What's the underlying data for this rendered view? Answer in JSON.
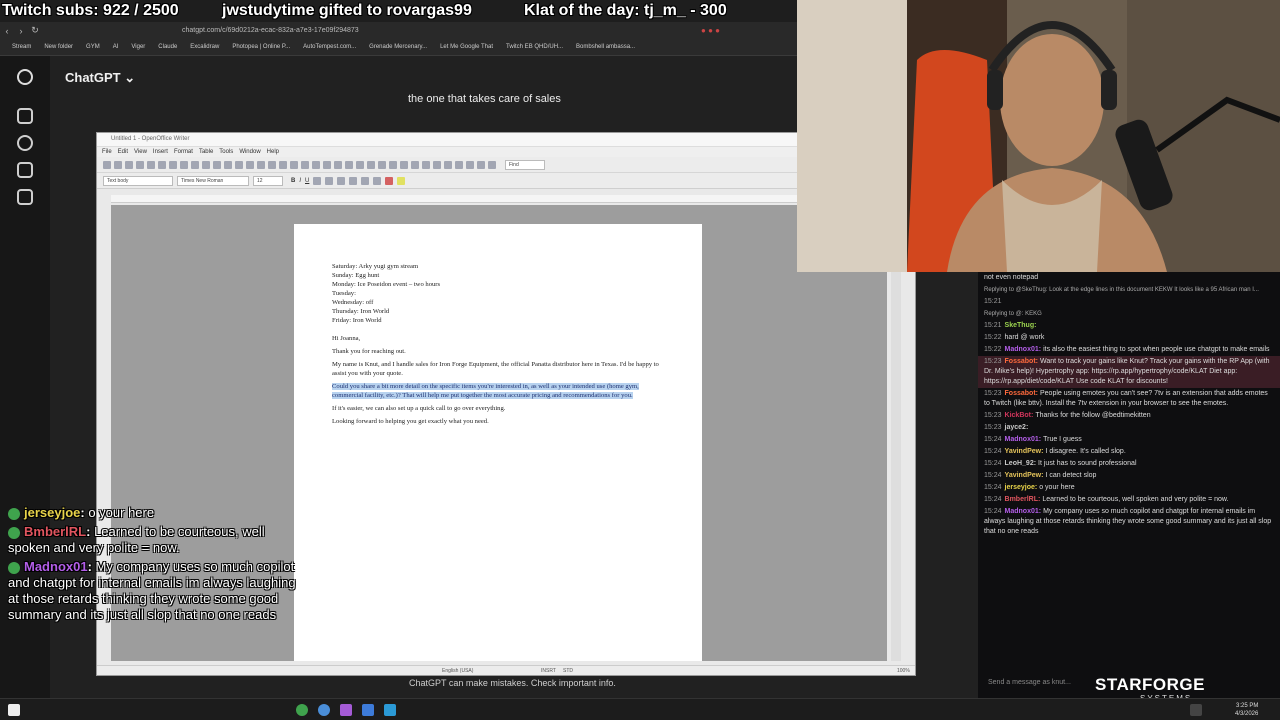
{
  "overlay": {
    "subs": "Twitch subs: 922 / 2500",
    "gift": "jwstudytime gifted to rovargas99",
    "klat": "Klat of the day: tj_m_ - 300"
  },
  "browser": {
    "url": "chatgpt.com/c/69d0212a-ecac-832a-a7e3-17e09f294873",
    "bookmarks": [
      "Stream",
      "New folder",
      "GYM",
      "AI",
      "Viger",
      "Claude",
      "Excalidraw",
      "Photopea | Online P...",
      "AutoTempest.com...",
      "Grenade Mercenary...",
      "Let Me Google That",
      "Twitch EB QHD/UH...",
      "Bombshell ambassa..."
    ]
  },
  "chatgpt": {
    "title": "ChatGPT",
    "bubble": "the one that takes care of sales",
    "footer": "ChatGPT can make mistakes. Check important info."
  },
  "writer": {
    "window_title": "Untitled 1 - OpenOffice Writer",
    "menu": [
      "File",
      "Edit",
      "View",
      "Insert",
      "Format",
      "Table",
      "Tools",
      "Window",
      "Help"
    ],
    "style": "Text body",
    "font": "Times New Roman",
    "size": "12",
    "find": "Find",
    "status_lang": "English (USA)",
    "status_mode": "INSRT",
    "status_std": "STD",
    "zoom": "100%",
    "doc": {
      "schedule": [
        "Saturday: Arky yugi gym stream",
        "Sunday: Egg hunt",
        "Monday: Ice Poseidon event – two hours",
        "Tuesday:",
        "Wednesday: off",
        "Thursday: Iron World",
        "Friday: Iron World"
      ],
      "greeting": "Hi Joanna,",
      "p1": "Thank you for reaching out.",
      "p2": "My name is Knut, and I handle sales for Iron Forge Equipment, the official Panatta distributor here in Texas. I'd be happy to assist you with your quote.",
      "p3": "Could you share a bit more detail on the specific items you're interested in, as well as your intended use (home gym, commercial facility, etc.)? That will help me put together the most accurate pricing and recommendations for you.",
      "p4": "If it's easier, we can also set up a quick call to go over everything.",
      "p5": "Looking forward to helping you get exactly what you need."
    }
  },
  "chat": {
    "input_placeholder": "Send a message as knut...",
    "messages": [
      {
        "ts": "",
        "nick": "",
        "text": "not even notepad",
        "color": "#ffffff"
      },
      {
        "ts": "",
        "nick": "",
        "reply": "Replying to @SkeThug: Look at the edge lines in this document KEKW It looks like a 95 African man I...",
        "text": "",
        "color": "#aaaaaa"
      },
      {
        "ts": "15:21",
        "nick": "",
        "text": "",
        "color": "#ffffff"
      },
      {
        "ts": "",
        "nick": "",
        "reply": "Replying to @: KEKG",
        "text": "",
        "color": "#aaaaaa"
      },
      {
        "ts": "15:21",
        "nick": "SkeThug:",
        "text": "",
        "color": "#9bd34f"
      },
      {
        "ts": "15:22",
        "nick": "",
        "text": "hard @ work",
        "color": "#e0555f"
      },
      {
        "ts": "15:22",
        "nick": "Madnox01:",
        "text": "its also the easiest thing to spot when people use chatgpt to make emails",
        "color": "#b35ee8"
      },
      {
        "ts": "15:23",
        "nick": "Fossabot:",
        "text": "Want to track your gains like Knut? Track your gains with the RP App (with Dr. Mike's help)! Hypertrophy app: https://rp.app/hypertrophy/code/KLAT Diet app: https://rp.app/diet/code/KLAT Use code KLAT for discounts!",
        "color": "#ff6a3d",
        "hl": true
      },
      {
        "ts": "15:23",
        "nick": "Fossabot:",
        "text": "People using emotes you can't see? 7tv is an extension that adds emotes to Twitch (like bttv). Install the 7tv extension in your browser to see the emotes.",
        "color": "#ff6a3d"
      },
      {
        "ts": "15:23",
        "nick": "KickBot:",
        "text": "Thanks for the follow @bedtimekitten",
        "color": "#d1355c"
      },
      {
        "ts": "15:23",
        "nick": "jayce2:",
        "text": "",
        "color": "#c8c8c8"
      },
      {
        "ts": "15:24",
        "nick": "Madnox01:",
        "text": "True I guess",
        "color": "#b35ee8"
      },
      {
        "ts": "15:24",
        "nick": "YavindPew:",
        "text": "I disagree. It's called slop.",
        "color": "#e3c25a"
      },
      {
        "ts": "15:24",
        "nick": "LeoH_92:",
        "text": "It just has to sound professional",
        "color": "#c8c8c8"
      },
      {
        "ts": "15:24",
        "nick": "YavindPew:",
        "text": "I can detect slop",
        "color": "#e3c25a"
      },
      {
        "ts": "15:24",
        "nick": "jerseyjoe:",
        "text": "o your here",
        "color": "#e8d34a"
      },
      {
        "ts": "15:24",
        "nick": "BmberlRL:",
        "text": "Learned to be courteous, well spoken and very polite = now.",
        "color": "#e0555f"
      },
      {
        "ts": "15:24",
        "nick": "Madnox01:",
        "text": "My company uses so much copilot and chatgpt for internal emails im always laughing at those retards thinking they wrote some good summary and its just all slop that no one reads",
        "color": "#b35ee8"
      }
    ]
  },
  "overlay_chat": [
    {
      "nick": "jerseyjoe",
      "msg": "o your here",
      "color": "#e8d34a"
    },
    {
      "nick": "BmberlRL",
      "msg": "Learned to be courteous, well spoken and very polite = now.",
      "color": "#e0555f"
    },
    {
      "nick": "Madnox01",
      "msg": "My company uses so much copilot and chatgpt for internal emails im always laughing at those retards thinking they wrote some good summary and its just all slop that no one reads",
      "color": "#b35ee8"
    }
  ],
  "sponsor": {
    "name": "STARFORGE",
    "sub": "SYSTEMS"
  },
  "taskbar": {
    "time": "3:25 PM",
    "date": "4/3/2026"
  }
}
